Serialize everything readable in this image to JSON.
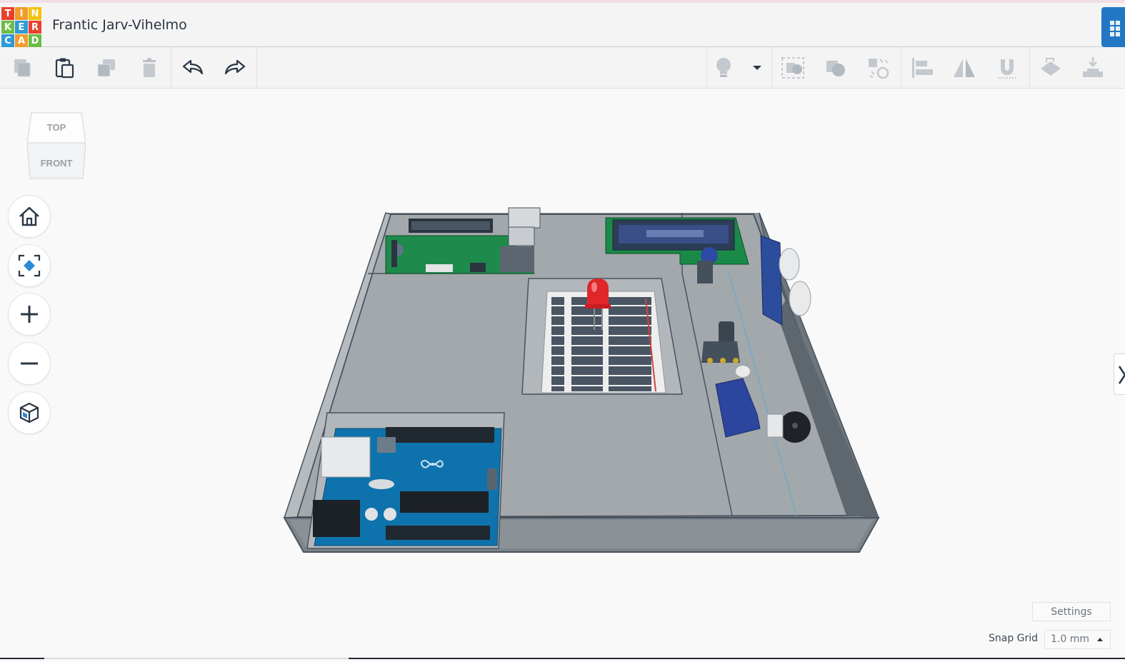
{
  "app": {
    "logo_letters": [
      "T",
      "I",
      "N",
      "K",
      "E",
      "R",
      "C",
      "A",
      "D"
    ],
    "logo_colors": [
      "#e8412c",
      "#f29c2a",
      "#f5c20c",
      "#6bbd45",
      "#2e9ad8",
      "#e8412c",
      "#2e9ad8",
      "#f29c2a",
      "#6bbd45"
    ],
    "project_title": "Frantic Jarv-Vihelmo"
  },
  "toolbar": {
    "left_tools": [
      {
        "name": "copy-icon",
        "enabled": false
      },
      {
        "name": "paste-icon",
        "enabled": true
      },
      {
        "name": "duplicate-icon",
        "enabled": false
      },
      {
        "name": "delete-icon",
        "enabled": false
      },
      {
        "name": "undo-icon",
        "enabled": true
      },
      {
        "name": "redo-icon",
        "enabled": true
      }
    ],
    "right_tools": [
      {
        "name": "show-hide-lightbulb-icon"
      },
      {
        "name": "visibility-dropdown-icon"
      },
      {
        "name": "group-icon"
      },
      {
        "name": "ungroup-icon"
      },
      {
        "name": "cruise-icon"
      },
      {
        "name": "align-icon"
      },
      {
        "name": "mirror-icon"
      },
      {
        "name": "workplane-magnet-icon"
      },
      {
        "name": "ruler-icon"
      },
      {
        "name": "import-icon"
      }
    ]
  },
  "viewcube": {
    "top_label": "TOP",
    "front_label": "FRONT"
  },
  "nav_controls": [
    "home-view-icon",
    "fit-view-icon",
    "zoom-in-icon",
    "zoom-out-icon",
    "perspective-icon"
  ],
  "footer": {
    "settings_label": "Settings",
    "snap_grid_label": "Snap Grid",
    "snap_grid_value": "1.0 mm"
  },
  "colors": {
    "accent": "#2277c4",
    "arduino": "#0e73ad",
    "led": "#e0262b",
    "pcb_green": "#1e8a4b",
    "enclosure": "#9da3a8"
  }
}
